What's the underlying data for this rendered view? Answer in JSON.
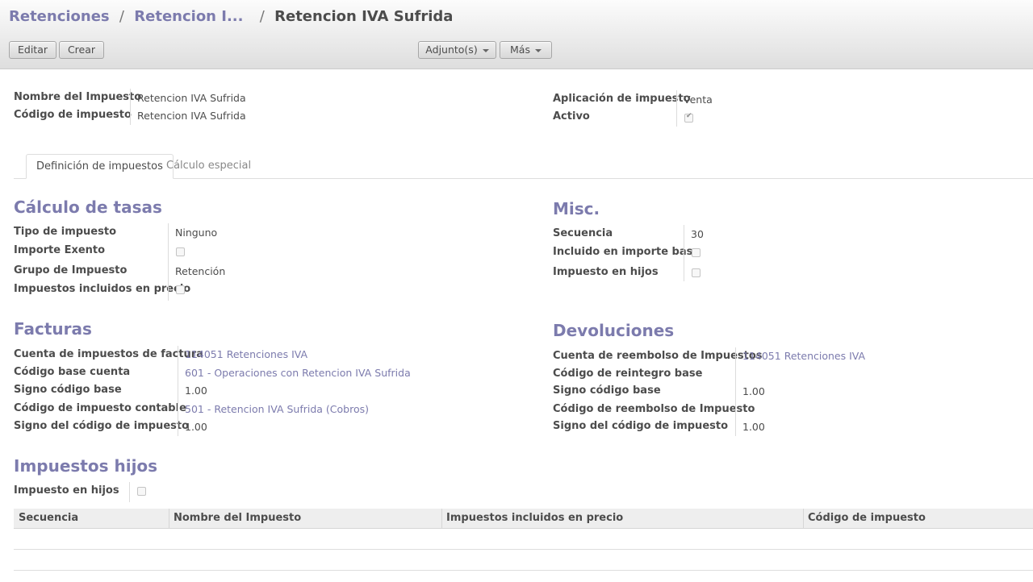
{
  "breadcrumb": {
    "items": [
      "Retenciones",
      "Retencion I..."
    ],
    "separator": "/",
    "current": "Retencion IVA Sufrida"
  },
  "toolbar": {
    "edit_label": "Editar",
    "create_label": "Crear",
    "attachments_label": "Adjunto(s)",
    "more_label": "Más"
  },
  "header_fields": {
    "tax_name_label": "Nombre del Impuesto",
    "tax_name_value": "Retencion IVA Sufrida",
    "tax_code_label": "Código de impuesto",
    "tax_code_value": "Retencion IVA Sufrida",
    "application_label": "Aplicación de impuesto",
    "application_value": "Venta",
    "active_label": "Activo",
    "active_checked": true
  },
  "tabs": [
    {
      "label": "Definición de impuestos",
      "active": true
    },
    {
      "label": "Cálculo especial",
      "active": false
    }
  ],
  "rates": {
    "title": "Cálculo de tasas",
    "tax_type_label": "Tipo de impuesto",
    "tax_type_value": "Ninguno",
    "exempt_label": "Importe Exento",
    "tax_group_label": "Grupo de Impuesto",
    "tax_group_value": "Retención",
    "price_include_label": "Impuestos incluidos en precio"
  },
  "misc": {
    "title": "Misc.",
    "sequence_label": "Secuencia",
    "sequence_value": "30",
    "include_base_label": "Incluido en importe base",
    "child_depend_label": "Impuesto en hijos"
  },
  "invoices": {
    "title": "Facturas",
    "account_label": "Cuenta de impuestos de factura",
    "account_value": "114051 Retenciones IVA",
    "base_code_label": "Código base cuenta",
    "base_code_value": "601 - Operaciones con Retencion IVA Sufrida",
    "base_sign_label": "Signo código base",
    "base_sign_value": "1.00",
    "tax_code_label": "Código de impuesto contable",
    "tax_code_value": "501 - Retencion IVA Sufrida (Cobros)",
    "tax_sign_label": "Signo del código de impuesto",
    "tax_sign_value": "1.00"
  },
  "refunds": {
    "title": "Devoluciones",
    "account_label": "Cuenta de reembolso de Impuestos",
    "account_value": "114051 Retenciones IVA",
    "base_code_label": "Código de reintegro base",
    "base_sign_label": "Signo código base",
    "base_sign_value": "1.00",
    "tax_code_label": "Código de reembolso de Impuesto",
    "tax_sign_label": "Signo del código de impuesto",
    "tax_sign_value": "1.00"
  },
  "children": {
    "title": "Impuestos hijos",
    "child_depend_label": "Impuesto en hijos",
    "columns": [
      "Secuencia",
      "Nombre del Impuesto",
      "Impuestos incluidos en precio",
      "Código de impuesto"
    ]
  },
  "colors": {
    "accent": "#7c7bad",
    "text": "#4c4c4c"
  }
}
